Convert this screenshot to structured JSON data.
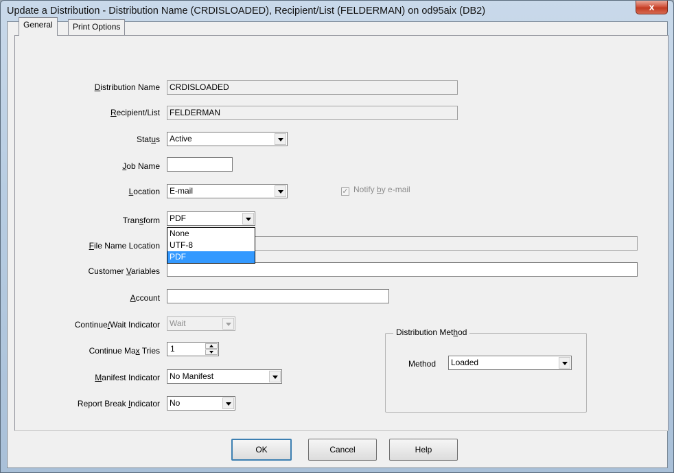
{
  "window": {
    "title": "Update a Distribution - Distribution Name (CRDISLOADED), Recipient/List (FELDERMAN) on od95aix (DB2)",
    "close_glyph": "x"
  },
  "tabs": [
    {
      "label": "General",
      "active": true
    },
    {
      "label": "Print Options",
      "active": false
    }
  ],
  "form": {
    "distribution_name": {
      "label_u": "D",
      "label_rest": "istribution Name",
      "value": "CRDISLOADED"
    },
    "recipient_list": {
      "label_u": "R",
      "label_rest": "ecipient/List",
      "value": "FELDERMAN"
    },
    "status": {
      "label_pre": "Stat",
      "label_u": "u",
      "label_rest": "s",
      "value": "Active"
    },
    "job_name": {
      "label_u": "J",
      "label_rest": "ob Name",
      "value": ""
    },
    "location": {
      "label_pre": "",
      "label_u": "L",
      "label_rest": "ocation",
      "value": "E-mail"
    },
    "notify": {
      "label_pre": "Notify ",
      "label_u": "b",
      "label_rest": "y e-mail",
      "checked": true,
      "check_glyph": "✓"
    },
    "transform": {
      "label_pre": "Tran",
      "label_u": "s",
      "label_rest": "form",
      "value": "PDF",
      "options": [
        "None",
        "UTF-8",
        "PDF"
      ],
      "selected": "PDF"
    },
    "file_name_location": {
      "label_u": "F",
      "label_rest": "ile Name Location",
      "value": ""
    },
    "customer_variables": {
      "label_pre": "Customer ",
      "label_u": "V",
      "label_rest": "ariables",
      "value": ""
    },
    "account": {
      "label_u": "A",
      "label_rest": "ccount",
      "value": ""
    },
    "continue_wait": {
      "label_pre": "Continue",
      "label_u": "/",
      "label_rest": "Wait Indicator",
      "value": "Wait"
    },
    "continue_max_tries": {
      "label_pre": "Continue Ma",
      "label_u": "x",
      "label_rest": " Tries",
      "value": "1"
    },
    "manifest": {
      "label_u": "M",
      "label_rest": "anifest Indicator",
      "value": "No Manifest"
    },
    "report_break": {
      "label_pre": "Report Break ",
      "label_u": "I",
      "label_rest": "ndicator",
      "value": "No"
    }
  },
  "distribution_method": {
    "title_pre": "Distribution Met",
    "title_u": "h",
    "title_rest": "od",
    "method_label": "Method",
    "method_value": "Loaded"
  },
  "buttons": {
    "ok": "OK",
    "cancel": "Cancel",
    "help": "Help"
  }
}
